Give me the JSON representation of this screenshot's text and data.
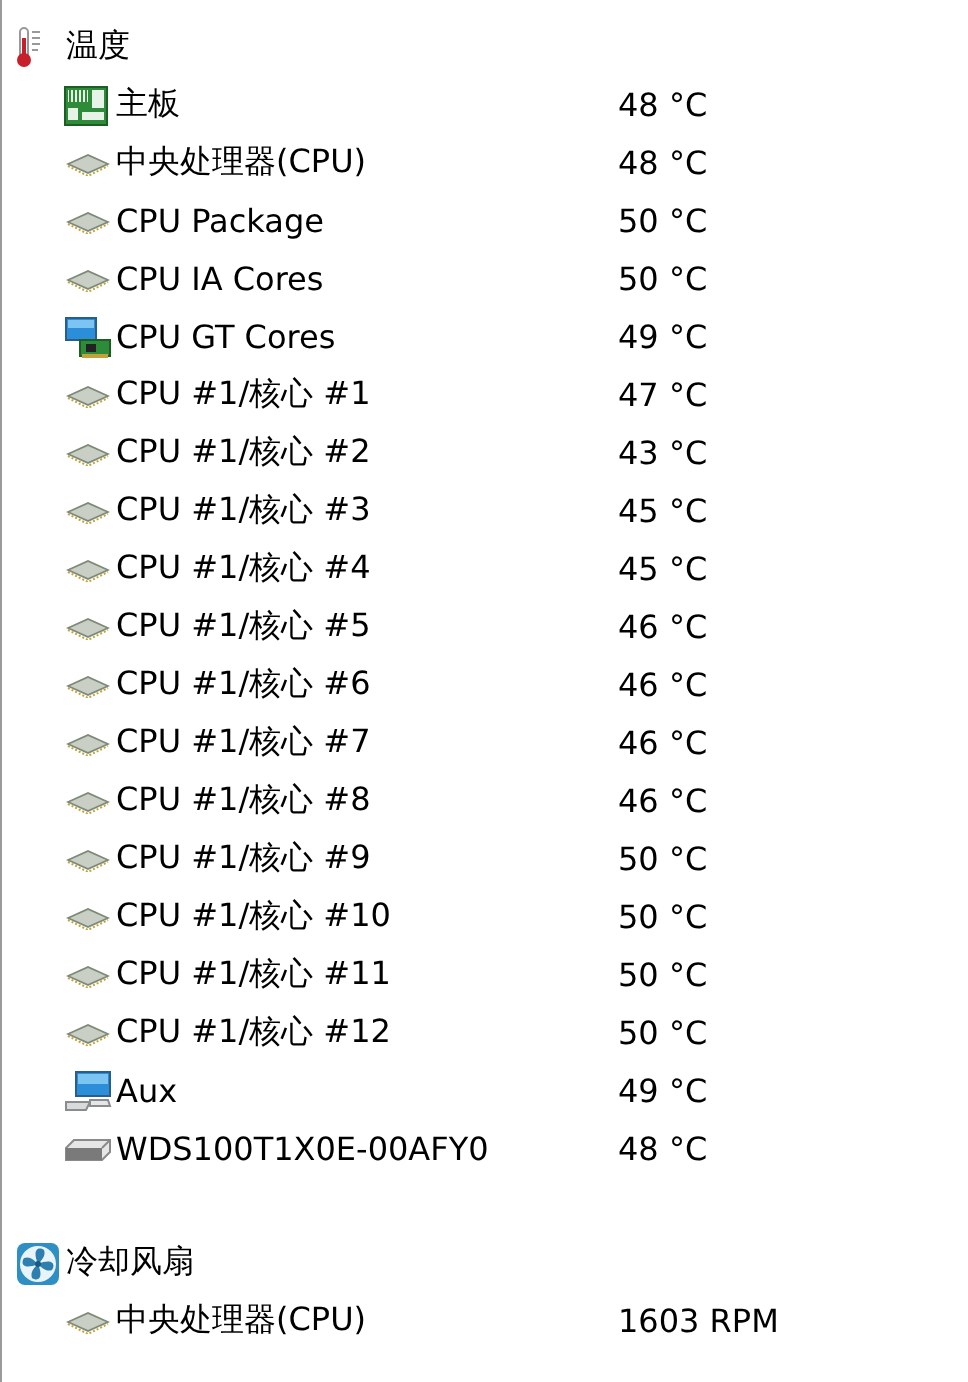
{
  "sections": [
    {
      "title": "温度",
      "kind": "thermometer",
      "items": [
        {
          "name": "主板",
          "value": "48 °C",
          "kind": "board"
        },
        {
          "name": "中央处理器(CPU)",
          "value": "48 °C",
          "kind": "cpu"
        },
        {
          "name": "CPU Package",
          "value": "50 °C",
          "kind": "cpu"
        },
        {
          "name": "CPU IA Cores",
          "value": "50 °C",
          "kind": "cpu"
        },
        {
          "name": "CPU GT Cores",
          "value": "49 °C",
          "kind": "gpu"
        },
        {
          "name": "CPU #1/核心 #1",
          "value": "47 °C",
          "kind": "cpu"
        },
        {
          "name": "CPU #1/核心 #2",
          "value": "43 °C",
          "kind": "cpu"
        },
        {
          "name": "CPU #1/核心 #3",
          "value": "45 °C",
          "kind": "cpu"
        },
        {
          "name": "CPU #1/核心 #4",
          "value": "45 °C",
          "kind": "cpu"
        },
        {
          "name": "CPU #1/核心 #5",
          "value": "46 °C",
          "kind": "cpu"
        },
        {
          "name": "CPU #1/核心 #6",
          "value": "46 °C",
          "kind": "cpu"
        },
        {
          "name": "CPU #1/核心 #7",
          "value": "46 °C",
          "kind": "cpu"
        },
        {
          "name": "CPU #1/核心 #8",
          "value": "46 °C",
          "kind": "cpu"
        },
        {
          "name": "CPU #1/核心 #9",
          "value": "50 °C",
          "kind": "cpu"
        },
        {
          "name": "CPU #1/核心 #10",
          "value": "50 °C",
          "kind": "cpu"
        },
        {
          "name": "CPU #1/核心 #11",
          "value": "50 °C",
          "kind": "cpu"
        },
        {
          "name": "CPU #1/核心 #12",
          "value": "50 °C",
          "kind": "cpu"
        },
        {
          "name": "Aux",
          "value": "49 °C",
          "kind": "computer"
        },
        {
          "name": "WDS100T1X0E-00AFY0",
          "value": "48 °C",
          "kind": "drive"
        }
      ]
    },
    {
      "title": "冷却风扇",
      "kind": "fan",
      "items": [
        {
          "name": "中央处理器(CPU)",
          "value": "1603 RPM",
          "kind": "cpu"
        }
      ]
    }
  ]
}
